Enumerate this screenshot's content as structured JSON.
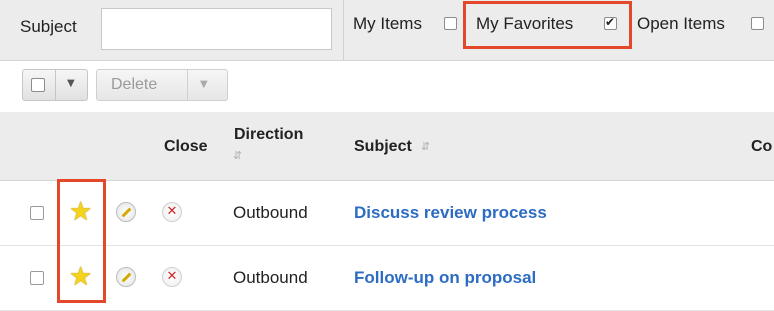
{
  "filters": {
    "subject_label": "Subject",
    "subject_value": "",
    "my_items_label": "My Items",
    "my_items_checked": false,
    "my_favorites_label": "My Favorites",
    "my_favorites_checked": true,
    "open_items_label": "Open Items",
    "open_items_checked": false
  },
  "actions": {
    "delete_label": "Delete"
  },
  "table": {
    "columns": {
      "close": "Close",
      "direction": "Direction",
      "subject": "Subject",
      "truncated": "Co"
    },
    "rows": [
      {
        "favorite": true,
        "direction": "Outbound",
        "subject": "Discuss review process"
      },
      {
        "favorite": true,
        "direction": "Outbound",
        "subject": "Follow-up on proposal"
      }
    ]
  },
  "colors": {
    "highlight": "#e4482a",
    "link": "#2c6cc2",
    "star": "#f5d21c",
    "close": "#d4252a"
  }
}
